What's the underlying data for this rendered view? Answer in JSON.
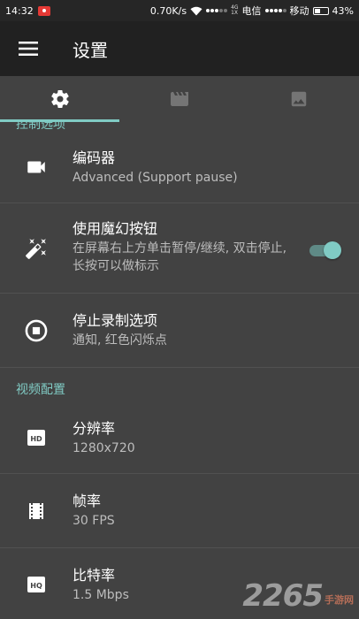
{
  "status_bar": {
    "time": "14:32",
    "net_speed": "0.70K/s",
    "sim_tag_top": "4G",
    "sim_tag_bottom": "1X",
    "carrier1": "电信",
    "carrier2": "移动",
    "battery": "43%"
  },
  "app_bar": {
    "title": "设置",
    "menu_icon": "hamburger-menu-icon"
  },
  "tabs": [
    {
      "icon": "gear-icon",
      "active": true
    },
    {
      "icon": "clapperboard-icon",
      "active": false
    },
    {
      "icon": "image-icon",
      "active": false
    }
  ],
  "list": {
    "partial_header": "控制选项",
    "items": [
      {
        "title": "编码器",
        "summary": "Advanced (Support pause)",
        "icon": "videocam-icon"
      },
      {
        "title": "使用魔幻按钮",
        "summary": "在屏幕右上方单击暂停/继续, 双击停止, 长按可以做标示",
        "icon": "magic-wand-icon",
        "toggle": true
      },
      {
        "title": "停止录制选项",
        "summary": "通知, 红色闪烁点",
        "icon": "stop-circle-icon"
      }
    ],
    "video_header": "视频配置",
    "video_items": [
      {
        "title": "分辨率",
        "summary": "1280x720",
        "icon": "hd-icon"
      },
      {
        "title": "帧率",
        "summary": "30 FPS",
        "icon": "film-strip-icon"
      },
      {
        "title": "比特率",
        "summary": "1.5 Mbps",
        "icon": "hq-icon"
      }
    ]
  },
  "watermark": {
    "number": "2265",
    "site": "手游网"
  },
  "colors": {
    "accent": "#80cbc4",
    "background": "#424242",
    "app_bar": "#212121",
    "status_bar": "#262626"
  }
}
